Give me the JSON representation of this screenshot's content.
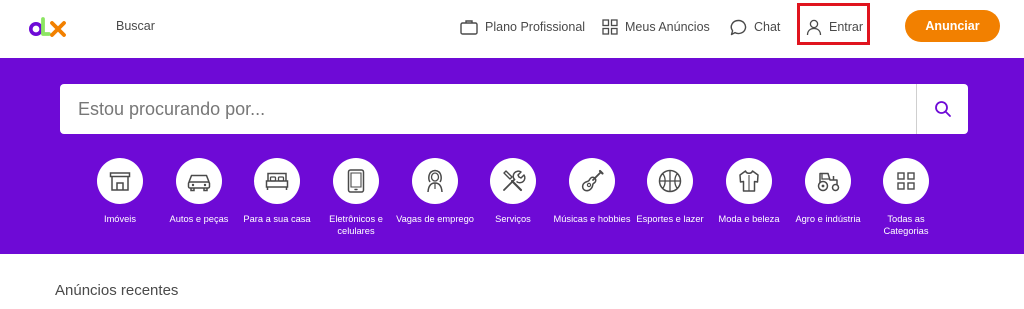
{
  "brand": {
    "name": "olx",
    "colors": {
      "o": "#6e0ad6",
      "l": "#8ce563",
      "x": "#f28000"
    }
  },
  "header": {
    "search_link": "Buscar",
    "nav": [
      {
        "label": "Plano Profissional",
        "icon": "briefcase-icon"
      },
      {
        "label": "Meus Anúncios",
        "icon": "grid-icon"
      },
      {
        "label": "Chat",
        "icon": "chat-bubble-icon"
      },
      {
        "label": "Entrar",
        "icon": "user-icon"
      }
    ],
    "cta_label": "Anunciar"
  },
  "search": {
    "placeholder": "Estou procurando por...",
    "value": ""
  },
  "categories": [
    {
      "label": "Imóveis",
      "icon": "store-icon"
    },
    {
      "label": "Autos e peças",
      "icon": "car-icon"
    },
    {
      "label": "Para a sua casa",
      "icon": "bed-icon"
    },
    {
      "label": "Eletrônicos e celulares",
      "icon": "tablet-icon"
    },
    {
      "label": "Vagas de emprego",
      "icon": "person-icon"
    },
    {
      "label": "Serviços",
      "icon": "tools-icon"
    },
    {
      "label": "Músicas e hobbies",
      "icon": "guitar-icon"
    },
    {
      "label": "Esportes e lazer",
      "icon": "basketball-icon"
    },
    {
      "label": "Moda e beleza",
      "icon": "shirt-icon"
    },
    {
      "label": "Agro e indústria",
      "icon": "tractor-icon"
    },
    {
      "label": "Todas as Categorias",
      "icon": "grid-icon"
    }
  ],
  "section_title": "Anúncios recentes",
  "colors": {
    "purple": "#6e0ad6",
    "orange": "#f28000",
    "highlight": "#e0141e"
  }
}
